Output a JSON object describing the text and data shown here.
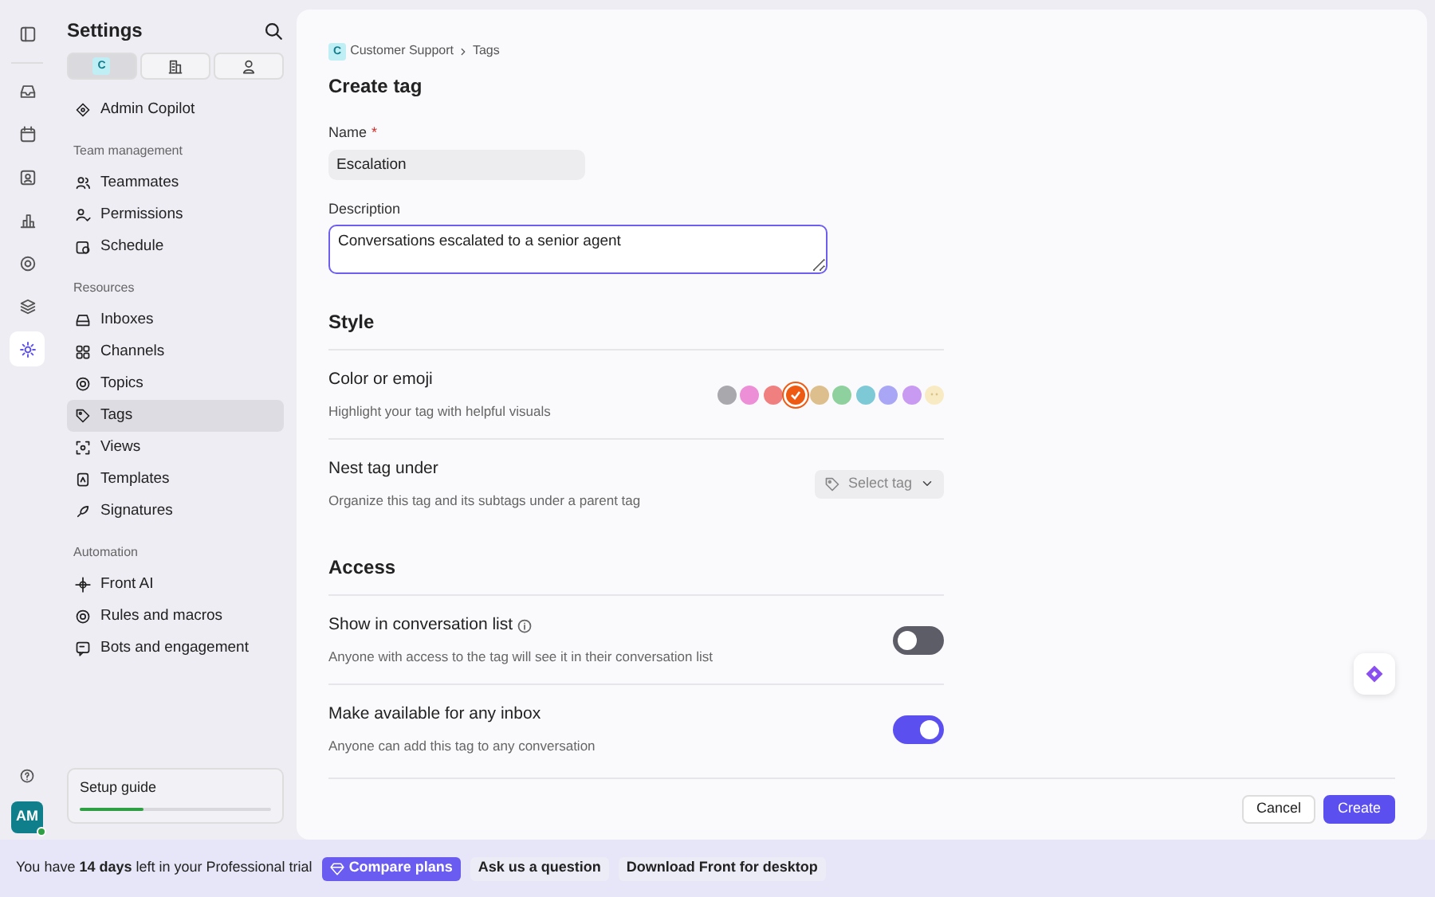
{
  "rail": {
    "items": [
      {
        "selected": false
      },
      {
        "selected": false
      },
      {
        "selected": false
      },
      {
        "selected": false
      },
      {
        "selected": false
      },
      {
        "selected": false
      },
      {
        "selected": true
      }
    ],
    "avatar": {
      "initials": "AM",
      "online": true
    }
  },
  "sidebar": {
    "title": "Settings",
    "scope_tabs": [
      {
        "badge": "C",
        "selected": true
      },
      {
        "selected": false
      },
      {
        "selected": false
      }
    ],
    "sections": [
      {
        "items": [
          {
            "label": "Admin Copilot",
            "selected": false
          }
        ]
      },
      {
        "heading": "Team management",
        "items": [
          {
            "label": "Teammates",
            "selected": false
          },
          {
            "label": "Permissions",
            "selected": false
          },
          {
            "label": "Schedule",
            "selected": false
          }
        ]
      },
      {
        "heading": "Resources",
        "items": [
          {
            "label": "Inboxes",
            "selected": false
          },
          {
            "label": "Channels",
            "selected": false
          },
          {
            "label": "Topics",
            "selected": false
          },
          {
            "label": "Tags",
            "selected": true
          },
          {
            "label": "Views",
            "selected": false
          },
          {
            "label": "Templates",
            "selected": false
          },
          {
            "label": "Signatures",
            "selected": false
          }
        ]
      },
      {
        "heading": "Automation",
        "items": [
          {
            "label": "Front AI",
            "selected": false
          },
          {
            "label": "Rules and macros",
            "selected": false
          },
          {
            "label": "Bots and engagement",
            "selected": false
          }
        ]
      }
    ],
    "setup_guide": {
      "label": "Setup guide",
      "level": 0.33
    }
  },
  "main": {
    "breadcrumb": {
      "badge": "C",
      "items": [
        "Customer Support",
        "Tags"
      ]
    },
    "title": "Create tag",
    "name_field": {
      "label": "Name",
      "required_mark": "*",
      "value": "Escalation"
    },
    "description_field": {
      "label": "Description",
      "value": "Conversations escalated to a senior agent",
      "focused": true
    },
    "sections": [
      {
        "title": "Style",
        "rows": [
          {
            "kind": "colors",
            "title": "Color or emoji",
            "subtitle": "Highlight your tag with helpful visuals",
            "swatches": [
              {
                "kind": "color",
                "color": "#a8a8ad",
                "selected": false
              },
              {
                "kind": "color",
                "color": "#ec8fd6",
                "selected": false
              },
              {
                "kind": "color",
                "color": "#f07f80",
                "selected": false
              },
              {
                "kind": "color",
                "color": "#ee5a12",
                "selected": true
              },
              {
                "kind": "color",
                "color": "#dcbf8c",
                "selected": false
              },
              {
                "kind": "color",
                "color": "#8fd19e",
                "selected": false
              },
              {
                "kind": "color",
                "color": "#7ec9d6",
                "selected": false
              },
              {
                "kind": "color",
                "color": "#a9a6f5",
                "selected": false
              },
              {
                "kind": "color",
                "color": "#c99af2",
                "selected": false
              },
              {
                "kind": "emoji",
                "color": "#f8ebc4",
                "selected": false
              }
            ]
          },
          {
            "kind": "select",
            "title": "Nest tag under",
            "subtitle": "Organize this tag and its subtags under a parent tag",
            "placeholder": "Select tag"
          }
        ]
      },
      {
        "title": "Access",
        "rows": [
          {
            "kind": "toggle",
            "title": "Show in conversation list",
            "info": true,
            "subtitle": "Anyone with access to the tag will see it in their conversation list",
            "on": false
          },
          {
            "kind": "toggle",
            "title": "Make available for any inbox",
            "info": false,
            "subtitle": "Anyone can add this tag to any conversation",
            "on": true
          }
        ]
      }
    ],
    "buttons": [
      {
        "label": "Cancel",
        "kind": "secondary"
      },
      {
        "label": "Create",
        "kind": "primary"
      }
    ]
  },
  "trial_bar": {
    "text": "You have **14 days** left in your Professional trial",
    "buttons": [
      {
        "label": "Compare plans",
        "kind": "primary"
      },
      {
        "label": "Ask us a question",
        "kind": "secondary"
      },
      {
        "label": "Download Front for desktop",
        "kind": "secondary"
      }
    ]
  }
}
